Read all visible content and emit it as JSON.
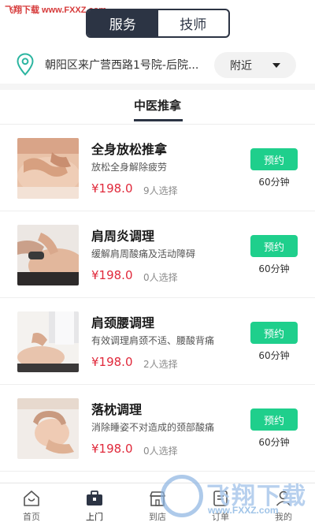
{
  "watermark_top": "飞翔下载 www.FXXZ.com",
  "segment": {
    "service_label": "服务",
    "therapist_label": "技师"
  },
  "location": {
    "address": "朝阳区来广营西路1号院-后院...",
    "nearby_label": "附近"
  },
  "category_tab": "中医推拿",
  "services": [
    {
      "title": "全身放松推拿",
      "desc": "放松全身解除疲劳",
      "price": "¥198.0",
      "count": "9人选择",
      "book_label": "预约",
      "duration": "60分钟"
    },
    {
      "title": "肩周炎调理",
      "desc": "缓解肩周酸痛及活动障碍",
      "price": "¥198.0",
      "count": "0人选择",
      "book_label": "预约",
      "duration": "60分钟"
    },
    {
      "title": "肩颈腰调理",
      "desc": "有效调理肩颈不适、腰酸背痛",
      "price": "¥198.0",
      "count": "2人选择",
      "book_label": "预约",
      "duration": "60分钟"
    },
    {
      "title": "落枕调理",
      "desc": "消除睡姿不对造成的颈部酸痛",
      "price": "¥198.0",
      "count": "0人选择",
      "book_label": "预约",
      "duration": "60分钟"
    }
  ],
  "tabbar": {
    "home": "首页",
    "visit": "上门",
    "store": "到店",
    "orders": "订单",
    "mine": "我的"
  },
  "watermark_bottom": {
    "title": "飞翔下载",
    "url": "www.FXXZ.com"
  },
  "colors": {
    "accent_dark": "#2c3444",
    "book_green": "#1fcf8c",
    "price_red": "#e0293b",
    "location_teal": "#2bb5a0"
  }
}
